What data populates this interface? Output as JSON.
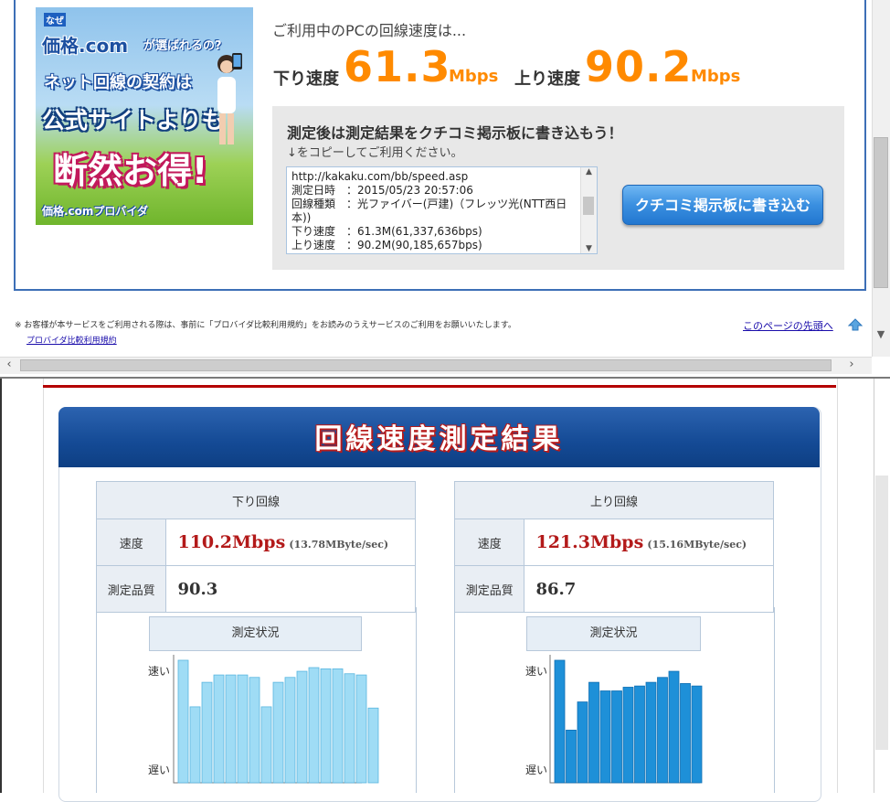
{
  "banner": {
    "small": "なぜ",
    "brand": "価格.com",
    "brand_suffix": "が選ばれるの?",
    "line2": "ネット回線の契約は",
    "line3": "公式サイトよりも",
    "line4": "断然お得!",
    "footer": "価格.comプロバイダ"
  },
  "speed": {
    "intro": "ご利用中のPCの回線速度は...",
    "down_label": "下り速度",
    "down_value": "61.3",
    "down_unit": "Mbps",
    "up_label": "上り速度",
    "up_value": "90.2",
    "up_unit": "Mbps"
  },
  "share": {
    "title": "測定後は測定結果をクチコミ掲示板に書き込もう！",
    "sub": "↓をコピーしてご利用ください。",
    "text": "http://kakaku.com/bb/speed.asp\n測定日時　：2015/05/23 20:57:06\n回線種類　：光ファイバー(戸建)（フレッツ光(NTT西日本))\n下り速度　：61.3M(61,337,636bps)\n上り速度　：90.2M(90,185,657bps)",
    "button": "クチコミ掲示板に書き込む"
  },
  "footer": {
    "notice": "※ お客様が本サービスをご利用される際は、事前に「プロバイダ比較利用規約」をお読みのうえサービスのご利用をお願いいたします。",
    "terms_link": "プロバイダ比較利用規約",
    "pagetop": "このページの先頭へ"
  },
  "result": {
    "title": "回線速度測定結果",
    "speed_label": "速度",
    "quality_label": "測定品質",
    "status_label": "測定状況",
    "fast": "速い",
    "slow": "遅い",
    "down": {
      "header": "下り回線",
      "speed": "110.2Mbps",
      "speed_sub": "(13.78MByte/sec)",
      "quality": "90.3"
    },
    "up": {
      "header": "上り回線",
      "speed": "121.3Mbps",
      "speed_sub": "(15.16MByte/sec)",
      "quality": "86.7"
    }
  },
  "chart_data": [
    {
      "type": "bar",
      "series": [
        {
          "values": [
            1.0,
            0.62,
            0.82,
            0.88,
            0.88,
            0.88,
            0.86,
            0.62,
            0.82,
            0.86,
            0.91,
            0.94,
            0.93,
            0.93,
            0.89,
            0.88,
            0.61
          ]
        }
      ],
      "ylabel_top": "速い",
      "ylabel_bottom": "遅い",
      "color": "#9fdcf5"
    },
    {
      "type": "bar",
      "series": [
        {
          "values": [
            1.0,
            0.43,
            0.66,
            0.82,
            0.75,
            0.75,
            0.78,
            0.79,
            0.82,
            0.86,
            0.91,
            0.81,
            0.79
          ]
        }
      ],
      "ylabel_top": "速い",
      "ylabel_bottom": "遅い",
      "color": "#1e90d8"
    }
  ]
}
